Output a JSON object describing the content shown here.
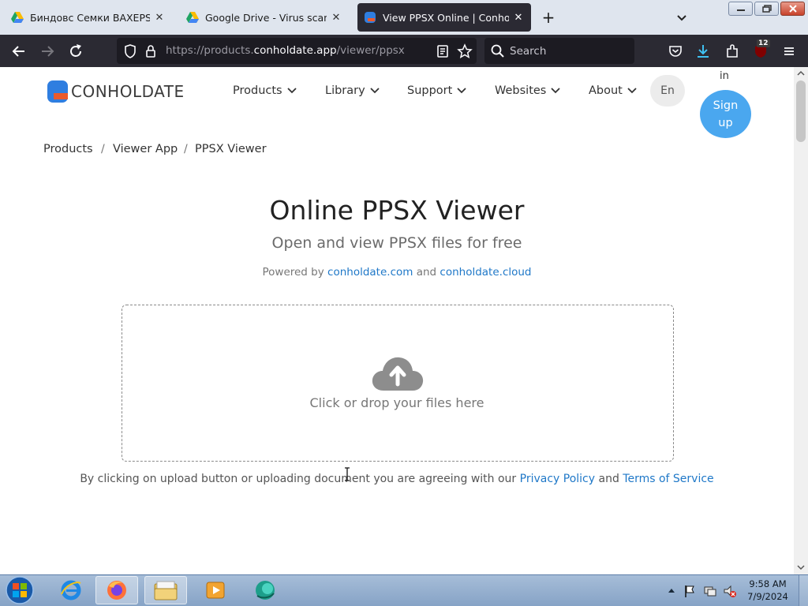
{
  "browser": {
    "tabs": [
      {
        "title": "Биндовс Семки BAXEPSOFT RT",
        "favicon": "google-drive-icon",
        "active": false
      },
      {
        "title": "Google Drive - Virus scan warni",
        "favicon": "google-drive-icon",
        "active": false
      },
      {
        "title": "View PPSX Online | Conholdate",
        "favicon": "conholdate-icon",
        "active": true
      }
    ],
    "url_scheme": "https://products.",
    "url_host": "conholdate.app",
    "url_path": "/viewer/ppsx",
    "search_placeholder": "Search",
    "extension_badge": "12"
  },
  "site": {
    "logo_text": "CONHOLDATE",
    "nav": [
      "Products",
      "Library",
      "Support",
      "Websites",
      "About"
    ],
    "lang": "En",
    "sign_in": "in",
    "sign_up_line1": "Sign",
    "sign_up_line2": "up",
    "brand_color": "#4aa7ef"
  },
  "breadcrumb": [
    "Products",
    "Viewer App",
    "PPSX Viewer"
  ],
  "main": {
    "title": "Online PPSX Viewer",
    "subtitle": "Open and view PPSX files for free",
    "powered_prefix": "Powered by",
    "powered_link1": "conholdate.com",
    "powered_and": "and",
    "powered_link2": "conholdate.cloud",
    "drop_text": "Click or drop your files here",
    "legal_prefix": "By clicking on upload button or uploading document you are agreeing with our",
    "privacy": "Privacy Policy",
    "legal_and": "and",
    "terms": "Terms of Service",
    "link_color": "#1f78c8"
  },
  "taskbar": {
    "apps": [
      "internet-explorer-icon",
      "firefox-icon",
      "file-explorer-icon",
      "media-player-icon",
      "app-icon"
    ],
    "time": "9:58 AM",
    "date": "7/9/2024"
  }
}
